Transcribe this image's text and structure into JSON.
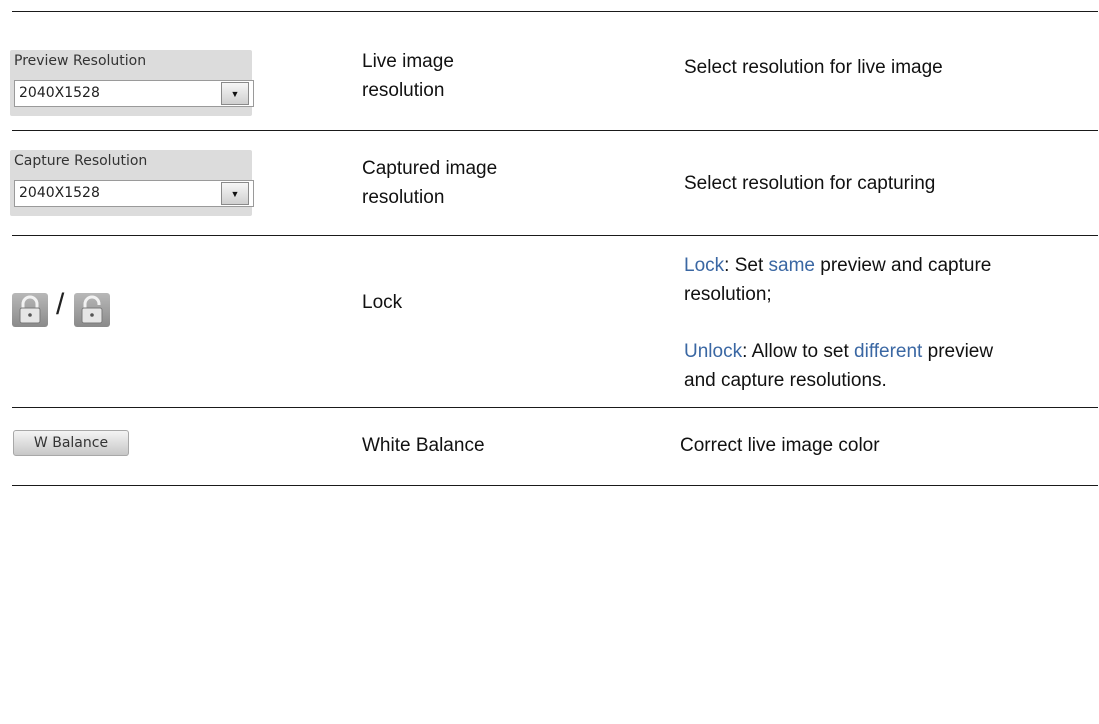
{
  "rows": [
    {
      "widget": {
        "label": "Preview Resolution",
        "value": "2040X1528",
        "dropdown_icon": "triangle-down-icon"
      },
      "name": [
        "Live image",
        "resolution"
      ],
      "description": "Select resolution for live image"
    },
    {
      "widget": {
        "label": "Capture Resolution",
        "value": "2040X1528",
        "dropdown_icon": "triangle-down-icon"
      },
      "name": [
        "Captured image",
        "resolution"
      ],
      "description": "Select resolution for capturing"
    },
    {
      "icons": [
        "lock-icon",
        "unlock-icon"
      ],
      "separator": "/",
      "name": "Lock",
      "lock_desc": {
        "keyword": "Lock",
        "prefix": ": Set ",
        "highlight": "same",
        "suffix": " preview and capture",
        "line2": "resolution;"
      },
      "unlock_desc": {
        "keyword": "Unlock",
        "prefix": ": Allow to set ",
        "highlight": "different",
        "suffix": " preview",
        "line2": "and capture resolutions."
      }
    },
    {
      "button_label": "W Balance",
      "name": "White Balance",
      "description": "Correct live image color"
    }
  ],
  "colors": {
    "highlight": "#3a67a3",
    "rule": "#1a1a1a"
  }
}
